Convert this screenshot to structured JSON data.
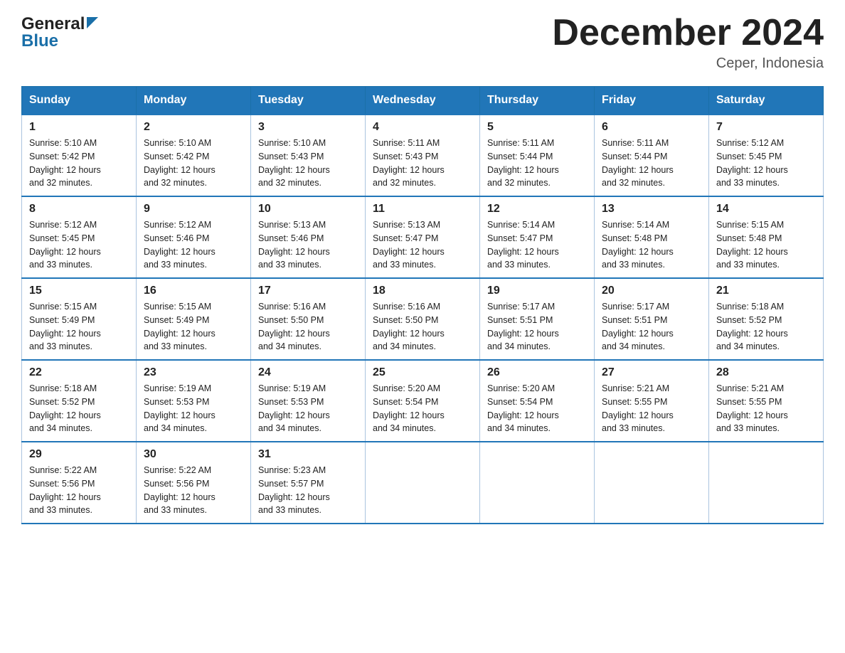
{
  "logo": {
    "general": "General",
    "blue": "Blue"
  },
  "title": "December 2024",
  "location": "Ceper, Indonesia",
  "days_of_week": [
    "Sunday",
    "Monday",
    "Tuesday",
    "Wednesday",
    "Thursday",
    "Friday",
    "Saturday"
  ],
  "weeks": [
    [
      {
        "day": "1",
        "sunrise": "5:10 AM",
        "sunset": "5:42 PM",
        "daylight": "12 hours and 32 minutes."
      },
      {
        "day": "2",
        "sunrise": "5:10 AM",
        "sunset": "5:42 PM",
        "daylight": "12 hours and 32 minutes."
      },
      {
        "day": "3",
        "sunrise": "5:10 AM",
        "sunset": "5:43 PM",
        "daylight": "12 hours and 32 minutes."
      },
      {
        "day": "4",
        "sunrise": "5:11 AM",
        "sunset": "5:43 PM",
        "daylight": "12 hours and 32 minutes."
      },
      {
        "day": "5",
        "sunrise": "5:11 AM",
        "sunset": "5:44 PM",
        "daylight": "12 hours and 32 minutes."
      },
      {
        "day": "6",
        "sunrise": "5:11 AM",
        "sunset": "5:44 PM",
        "daylight": "12 hours and 32 minutes."
      },
      {
        "day": "7",
        "sunrise": "5:12 AM",
        "sunset": "5:45 PM",
        "daylight": "12 hours and 33 minutes."
      }
    ],
    [
      {
        "day": "8",
        "sunrise": "5:12 AM",
        "sunset": "5:45 PM",
        "daylight": "12 hours and 33 minutes."
      },
      {
        "day": "9",
        "sunrise": "5:12 AM",
        "sunset": "5:46 PM",
        "daylight": "12 hours and 33 minutes."
      },
      {
        "day": "10",
        "sunrise": "5:13 AM",
        "sunset": "5:46 PM",
        "daylight": "12 hours and 33 minutes."
      },
      {
        "day": "11",
        "sunrise": "5:13 AM",
        "sunset": "5:47 PM",
        "daylight": "12 hours and 33 minutes."
      },
      {
        "day": "12",
        "sunrise": "5:14 AM",
        "sunset": "5:47 PM",
        "daylight": "12 hours and 33 minutes."
      },
      {
        "day": "13",
        "sunrise": "5:14 AM",
        "sunset": "5:48 PM",
        "daylight": "12 hours and 33 minutes."
      },
      {
        "day": "14",
        "sunrise": "5:15 AM",
        "sunset": "5:48 PM",
        "daylight": "12 hours and 33 minutes."
      }
    ],
    [
      {
        "day": "15",
        "sunrise": "5:15 AM",
        "sunset": "5:49 PM",
        "daylight": "12 hours and 33 minutes."
      },
      {
        "day": "16",
        "sunrise": "5:15 AM",
        "sunset": "5:49 PM",
        "daylight": "12 hours and 33 minutes."
      },
      {
        "day": "17",
        "sunrise": "5:16 AM",
        "sunset": "5:50 PM",
        "daylight": "12 hours and 34 minutes."
      },
      {
        "day": "18",
        "sunrise": "5:16 AM",
        "sunset": "5:50 PM",
        "daylight": "12 hours and 34 minutes."
      },
      {
        "day": "19",
        "sunrise": "5:17 AM",
        "sunset": "5:51 PM",
        "daylight": "12 hours and 34 minutes."
      },
      {
        "day": "20",
        "sunrise": "5:17 AM",
        "sunset": "5:51 PM",
        "daylight": "12 hours and 34 minutes."
      },
      {
        "day": "21",
        "sunrise": "5:18 AM",
        "sunset": "5:52 PM",
        "daylight": "12 hours and 34 minutes."
      }
    ],
    [
      {
        "day": "22",
        "sunrise": "5:18 AM",
        "sunset": "5:52 PM",
        "daylight": "12 hours and 34 minutes."
      },
      {
        "day": "23",
        "sunrise": "5:19 AM",
        "sunset": "5:53 PM",
        "daylight": "12 hours and 34 minutes."
      },
      {
        "day": "24",
        "sunrise": "5:19 AM",
        "sunset": "5:53 PM",
        "daylight": "12 hours and 34 minutes."
      },
      {
        "day": "25",
        "sunrise": "5:20 AM",
        "sunset": "5:54 PM",
        "daylight": "12 hours and 34 minutes."
      },
      {
        "day": "26",
        "sunrise": "5:20 AM",
        "sunset": "5:54 PM",
        "daylight": "12 hours and 34 minutes."
      },
      {
        "day": "27",
        "sunrise": "5:21 AM",
        "sunset": "5:55 PM",
        "daylight": "12 hours and 33 minutes."
      },
      {
        "day": "28",
        "sunrise": "5:21 AM",
        "sunset": "5:55 PM",
        "daylight": "12 hours and 33 minutes."
      }
    ],
    [
      {
        "day": "29",
        "sunrise": "5:22 AM",
        "sunset": "5:56 PM",
        "daylight": "12 hours and 33 minutes."
      },
      {
        "day": "30",
        "sunrise": "5:22 AM",
        "sunset": "5:56 PM",
        "daylight": "12 hours and 33 minutes."
      },
      {
        "day": "31",
        "sunrise": "5:23 AM",
        "sunset": "5:57 PM",
        "daylight": "12 hours and 33 minutes."
      },
      null,
      null,
      null,
      null
    ]
  ],
  "labels": {
    "sunrise": "Sunrise:",
    "sunset": "Sunset:",
    "daylight": "Daylight:"
  }
}
